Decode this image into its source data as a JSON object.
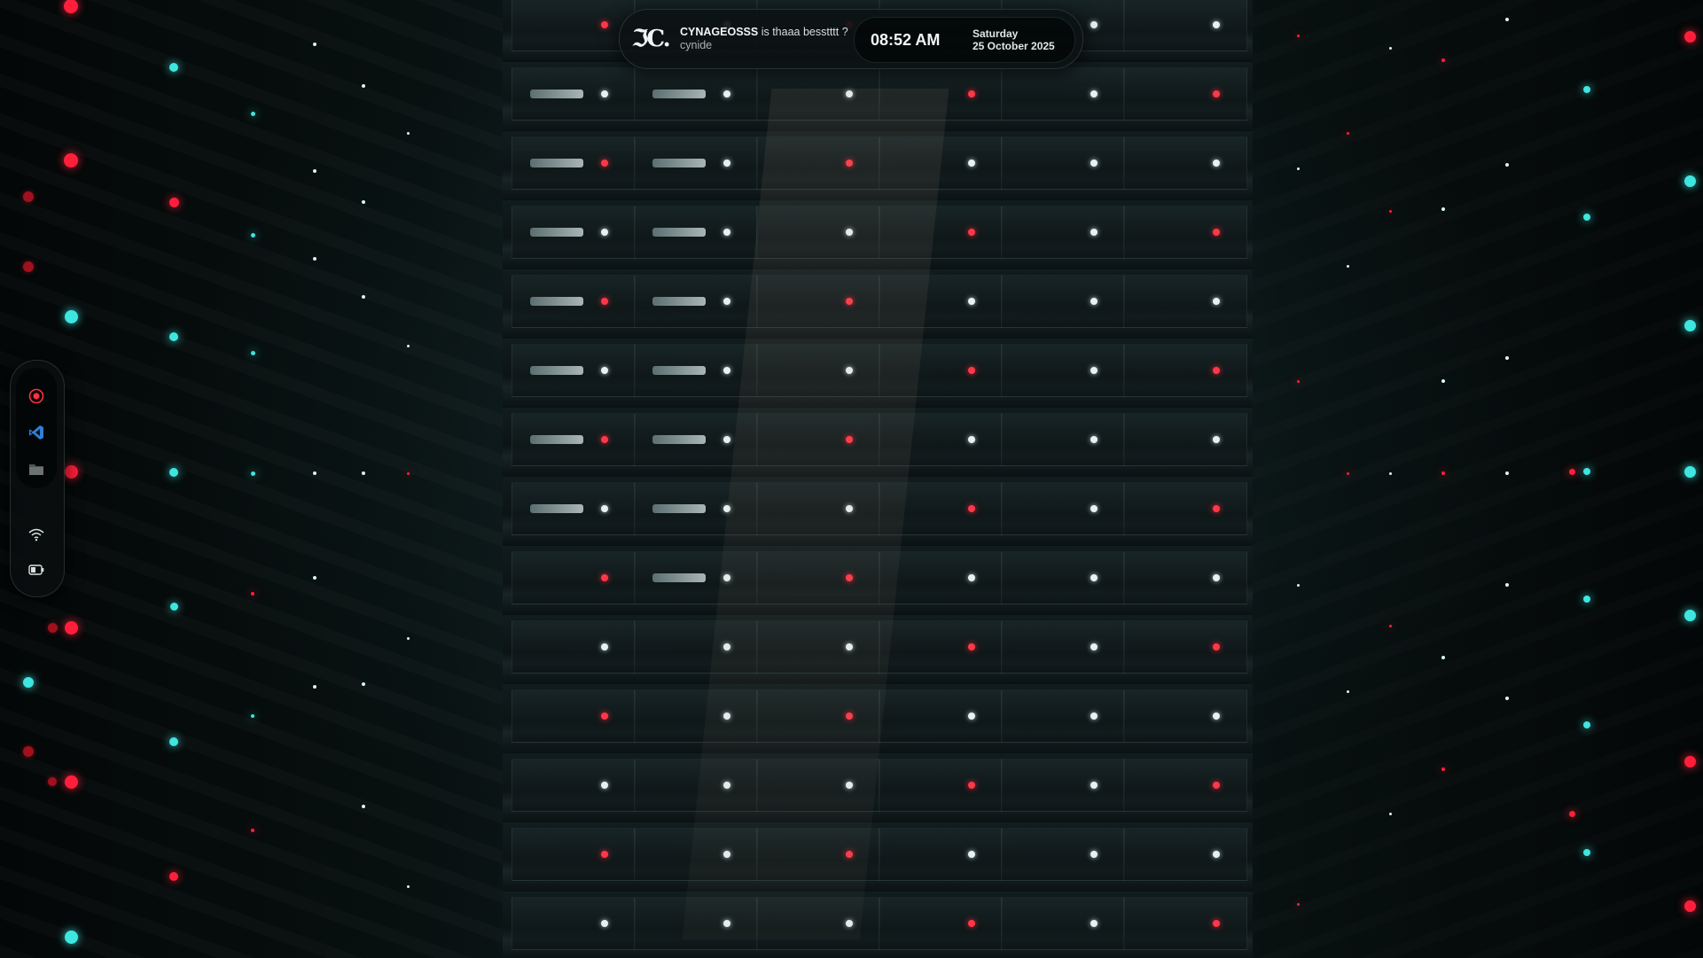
{
  "top_bar": {
    "media": {
      "logo_icon": "jc-logo-icon",
      "title": "CYNAGEOSSS",
      "subtitle_suffix": " is thaaa besstttt ?",
      "artist": "cynide"
    },
    "clock": {
      "time": "08:52 AM",
      "day": "Saturday",
      "date": "25 October 2025"
    }
  },
  "dock": {
    "apps": [
      {
        "name": "screen-recorder-icon",
        "color": "#ff3040"
      },
      {
        "name": "vscode-icon",
        "color": "#3a8ee6"
      },
      {
        "name": "file-manager-icon",
        "color": "#6b7272"
      }
    ],
    "status": [
      {
        "name": "wifi-icon"
      },
      {
        "name": "battery-icon"
      }
    ]
  },
  "colors": {
    "accent_red": "#ff1f3a",
    "accent_cyan": "#3ee6e0",
    "panel_bg": "#0c1213"
  }
}
